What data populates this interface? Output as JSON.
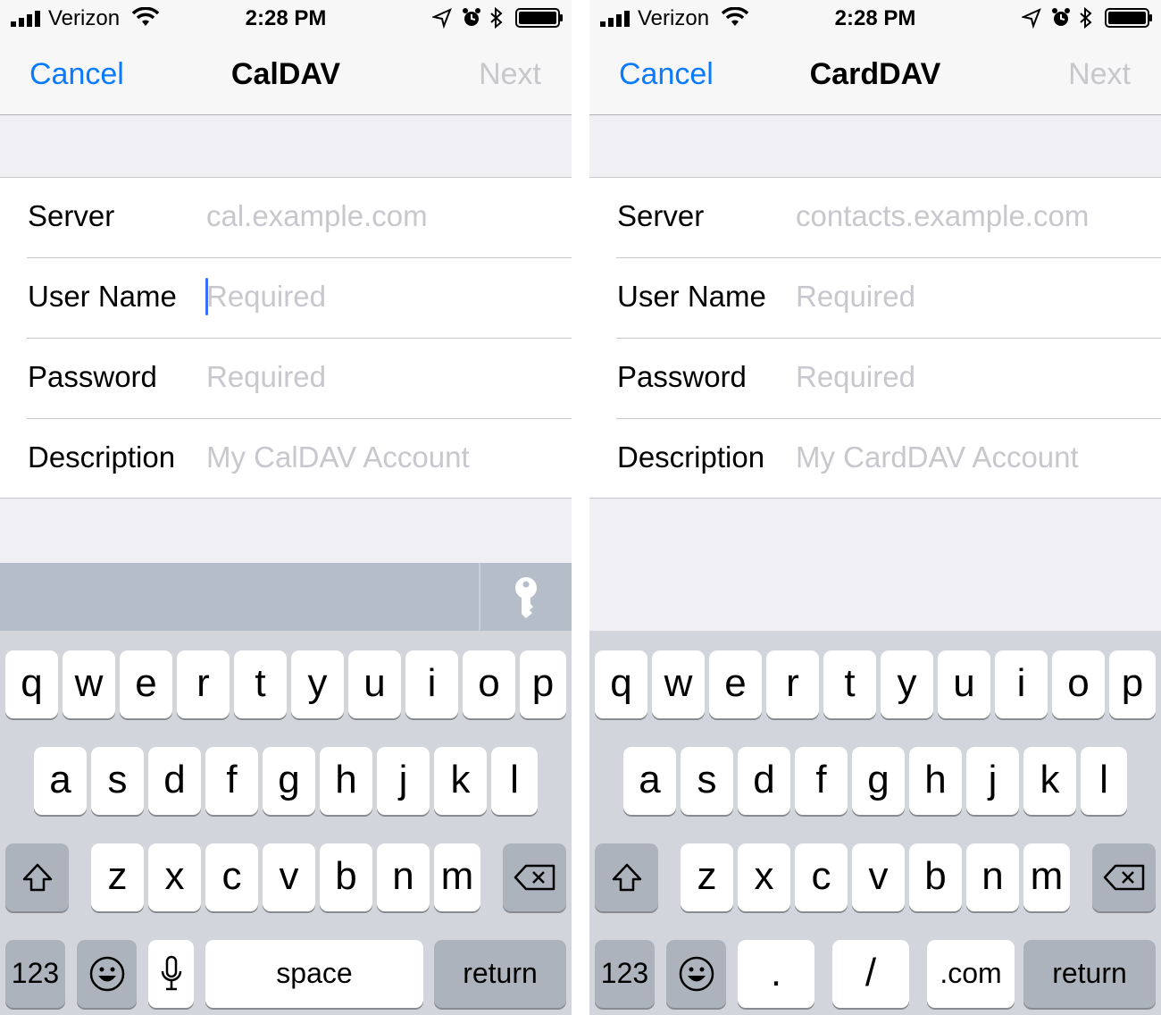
{
  "status": {
    "carrier": "Verizon",
    "time": "2:28 PM"
  },
  "left": {
    "nav": {
      "cancel": "Cancel",
      "title": "CalDAV",
      "next": "Next"
    },
    "fields": [
      {
        "label": "Server",
        "placeholder": "cal.example.com"
      },
      {
        "label": "User Name",
        "placeholder": "Required"
      },
      {
        "label": "Password",
        "placeholder": "Required"
      },
      {
        "label": "Description",
        "placeholder": "My CalDAV Account"
      }
    ],
    "keyboard": {
      "row1": [
        "q",
        "w",
        "e",
        "r",
        "t",
        "y",
        "u",
        "i",
        "o",
        "p"
      ],
      "row2": [
        "a",
        "s",
        "d",
        "f",
        "g",
        "h",
        "j",
        "k",
        "l"
      ],
      "row3": [
        "z",
        "x",
        "c",
        "v",
        "b",
        "n",
        "m"
      ],
      "numbers": "123",
      "space": "space",
      "return": "return"
    }
  },
  "right": {
    "nav": {
      "cancel": "Cancel",
      "title": "CardDAV",
      "next": "Next"
    },
    "fields": [
      {
        "label": "Server",
        "placeholder": "contacts.example.com"
      },
      {
        "label": "User Name",
        "placeholder": "Required"
      },
      {
        "label": "Password",
        "placeholder": "Required"
      },
      {
        "label": "Description",
        "placeholder": "My CardDAV Account"
      }
    ],
    "keyboard": {
      "row1": [
        "q",
        "w",
        "e",
        "r",
        "t",
        "y",
        "u",
        "i",
        "o",
        "p"
      ],
      "row2": [
        "a",
        "s",
        "d",
        "f",
        "g",
        "h",
        "j",
        "k",
        "l"
      ],
      "row3": [
        "z",
        "x",
        "c",
        "v",
        "b",
        "n",
        "m"
      ],
      "numbers": "123",
      "dot": ".",
      "slash": "/",
      "dotcom": ".com",
      "return": "return"
    }
  },
  "colors": {
    "accent": "#0a7aff",
    "placeholder": "#c7c7cd",
    "cursor": "#3d6cf5",
    "disabled": "#c7c7cc"
  }
}
